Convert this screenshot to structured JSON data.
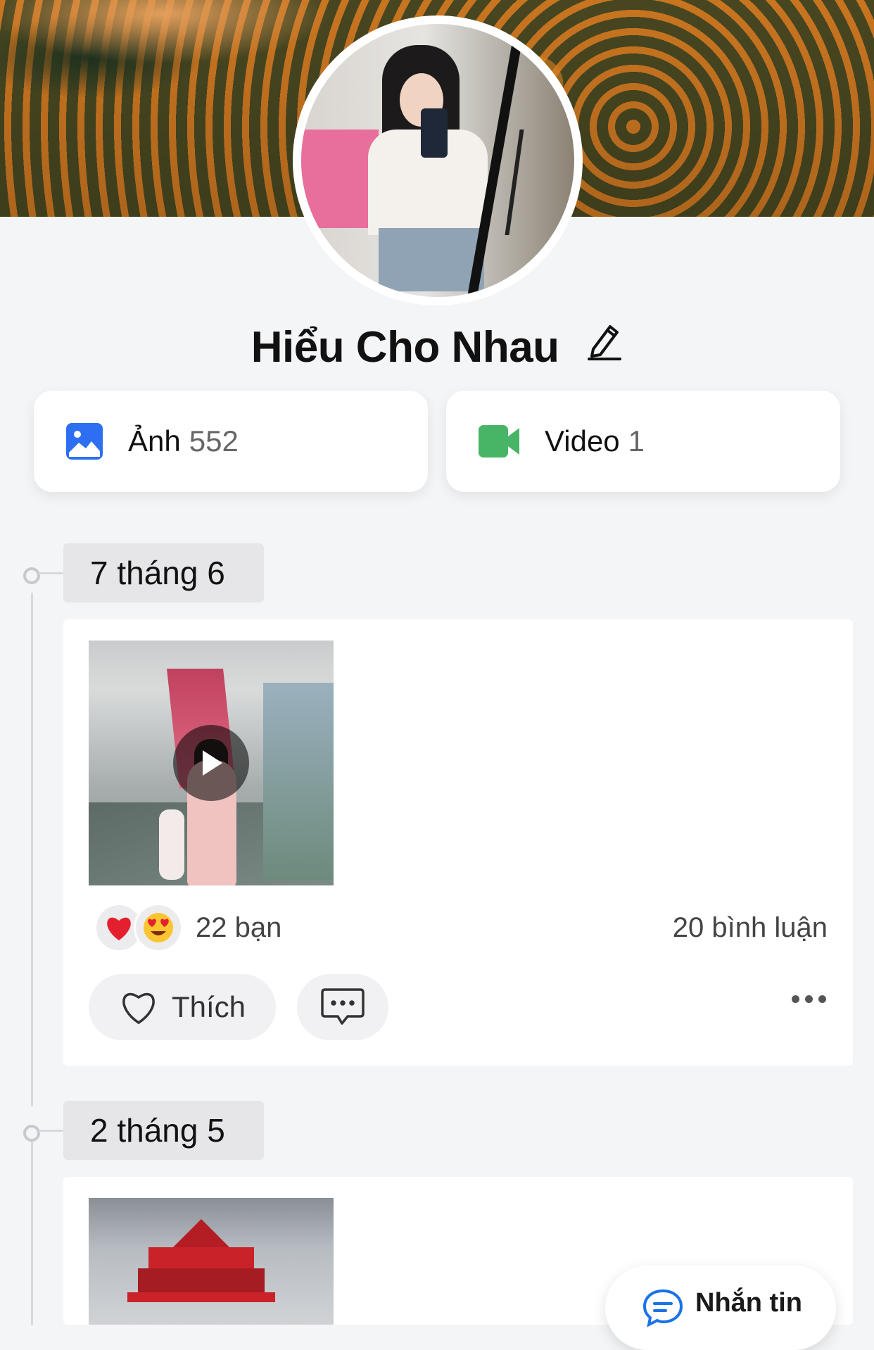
{
  "profile": {
    "name": "Hiểu Cho Nhau"
  },
  "media": {
    "photos_label": "Ảnh",
    "photos_count": "552",
    "videos_label": "Video",
    "videos_count": "1"
  },
  "timeline": [
    {
      "date": "7 tháng 6",
      "is_video": true,
      "reaction_icons": [
        "heart-emoji",
        "heart-eyes-emoji"
      ],
      "reactions_text": "22 bạn",
      "comments_text": "20 bình luận",
      "like_label": "Thích"
    },
    {
      "date": "2 tháng 5"
    }
  ],
  "floating": {
    "message_label": "Nhắn tin"
  },
  "colors": {
    "photo_icon": "#2d6ff0",
    "video_icon": "#47b565",
    "message_icon": "#1a73e8"
  }
}
